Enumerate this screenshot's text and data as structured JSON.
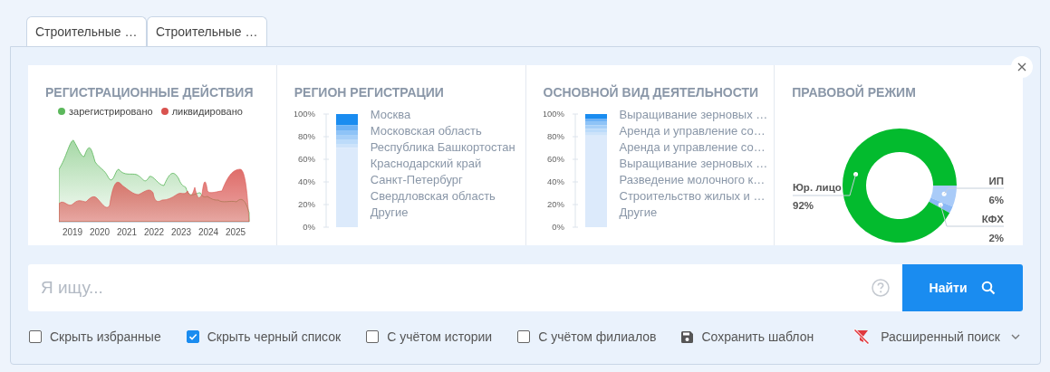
{
  "tabs": [
    {
      "label": "Строительные …"
    },
    {
      "label": "Строительные …"
    }
  ],
  "stats": {
    "registrations": {
      "title": "РЕГИСТРАЦИОННЫЕ ДЕЙСТВИЯ",
      "legend": [
        {
          "label": "зарегистрировано",
          "color": "#5cb85c"
        },
        {
          "label": "ликвидировано",
          "color": "#d9534f"
        }
      ],
      "years": [
        "2019",
        "2020",
        "2021",
        "2022",
        "2023",
        "2024",
        "2025"
      ]
    },
    "region": {
      "title": "РЕГИОН РЕГИСТРАЦИИ",
      "chart_data": {
        "type": "bar",
        "stacked": true,
        "categories": [
          null
        ],
        "yticks": [
          {
            "value": 0,
            "label": "0%"
          },
          {
            "value": 20,
            "label": "20%"
          },
          {
            "value": 40,
            "label": "40%"
          },
          {
            "value": 60,
            "label": "60%"
          },
          {
            "value": 80,
            "label": "80%"
          },
          {
            "value": 100,
            "label": "100%"
          }
        ],
        "ylim": [
          0,
          100
        ],
        "series": [
          {
            "name": "Москва",
            "color": "#1a8cf0",
            "values": [
              10
            ]
          },
          {
            "name": "Московская область",
            "color": "#6eb2f5",
            "values": [
              5
            ]
          },
          {
            "name": "Республика Башкортостан",
            "color": "#8ec3f7",
            "values": [
              4
            ]
          },
          {
            "name": "Краснодарский край",
            "color": "#a6cff8",
            "values": [
              4
            ]
          },
          {
            "name": "Санкт-Петербург",
            "color": "#bcdbfa",
            "values": [
              4
            ]
          },
          {
            "name": "Свердловская область",
            "color": "#cde3fa",
            "values": [
              3
            ]
          },
          {
            "name": "Другие",
            "color": "#dceafb",
            "values": [
              70
            ]
          }
        ]
      }
    },
    "activity": {
      "title": "ОСНОВНОЙ ВИД ДЕЯТЕЛЬНОСТИ",
      "axis_labels": [
        "100%",
        "80%",
        "60%",
        "40%",
        "20%",
        "0%"
      ],
      "items": [
        "Выращивание зерновых …",
        "Аренда и управление со…",
        "Аренда и управление со…",
        "Выращивание зерновых …",
        "Разведение молочного к…",
        "Строительство жилых и …",
        "Другие"
      ]
    },
    "legal": {
      "title": "ПРАВОВОЙ РЕЖИМ",
      "chart_data": {
        "type": "donut",
        "categories": [
          "Юр. лицо",
          "ИП",
          "КФХ"
        ],
        "values": [
          92,
          6,
          2
        ],
        "value_labels": [
          "92%",
          "6%",
          "2%"
        ]
      }
    }
  },
  "search": {
    "placeholder": "Я ищу...",
    "button": "Найти"
  },
  "options": [
    {
      "kind": "checkbox",
      "label": "Скрыть избранные",
      "checked": false
    },
    {
      "kind": "checkbox",
      "label": "Скрыть черный список",
      "checked": true
    },
    {
      "kind": "checkbox",
      "label": "С учётом истории",
      "checked": false
    },
    {
      "kind": "checkbox",
      "label": "С учётом филиалов",
      "checked": false
    },
    {
      "kind": "save",
      "label": "Сохранить шаблон"
    }
  ],
  "advanced": {
    "label": "Расширенный поиск"
  }
}
